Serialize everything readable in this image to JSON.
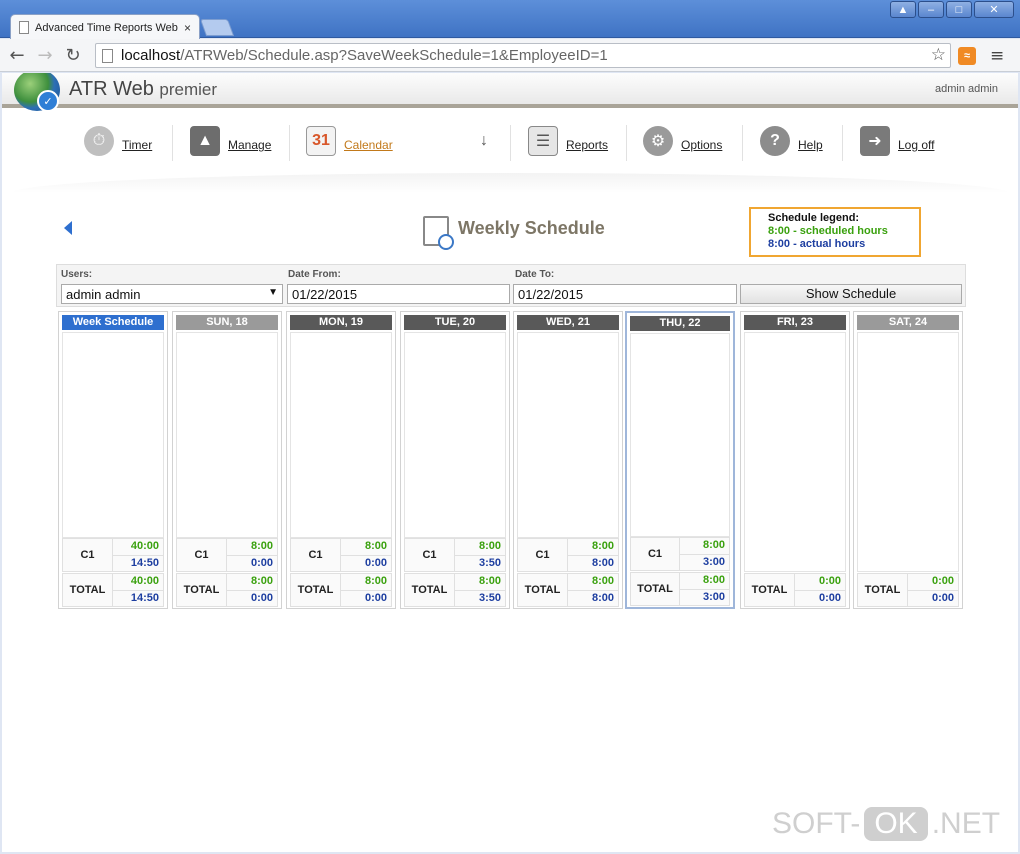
{
  "browser": {
    "tab_title": "Advanced Time Reports Web",
    "tab_close": "×",
    "window_buttons": [
      "▲",
      "–",
      "□",
      "✕"
    ],
    "url_host": "localhost",
    "url_path": "/ATRWeb/Schedule.asp?SaveWeekSchedule=1&EmployeeID=1"
  },
  "app": {
    "brand": "ATR Web",
    "brand_sub": "premier",
    "user": "admin admin"
  },
  "nav": {
    "timer": "Timer",
    "manage": "Manage",
    "calendar": "Calendar",
    "reports": "Reports",
    "options": "Options",
    "help": "Help",
    "logoff": "Log off",
    "calendar_day": "31"
  },
  "page": {
    "title": "Weekly Schedule"
  },
  "legend": {
    "title": "Schedule legend:",
    "scheduled": "8:00 - scheduled hours",
    "actual": "8:00 - actual hours"
  },
  "filters": {
    "users_label": "Users:",
    "users_value": "admin admin",
    "date_from_label": "Date From:",
    "date_from_value": "01/22/2015",
    "date_to_label": "Date To:",
    "date_to_value": "01/22/2015",
    "show_button": "Show Schedule"
  },
  "columns": [
    {
      "header": "Week Schedule",
      "row_label": "C1",
      "sched": "40:00",
      "actual": "14:50",
      "total_label": "TOTAL",
      "total_sched": "40:00",
      "total_actual": "14:50"
    },
    {
      "header": "SUN, 18",
      "row_label": "C1",
      "sched": "8:00",
      "actual": "0:00",
      "total_label": "TOTAL",
      "total_sched": "8:00",
      "total_actual": "0:00"
    },
    {
      "header": "MON, 19",
      "row_label": "C1",
      "sched": "8:00",
      "actual": "0:00",
      "total_label": "TOTAL",
      "total_sched": "8:00",
      "total_actual": "0:00"
    },
    {
      "header": "TUE, 20",
      "row_label": "C1",
      "sched": "8:00",
      "actual": "3:50",
      "total_label": "TOTAL",
      "total_sched": "8:00",
      "total_actual": "3:50"
    },
    {
      "header": "WED, 21",
      "row_label": "C1",
      "sched": "8:00",
      "actual": "8:00",
      "total_label": "TOTAL",
      "total_sched": "8:00",
      "total_actual": "8:00"
    },
    {
      "header": "THU, 22",
      "row_label": "C1",
      "sched": "8:00",
      "actual": "3:00",
      "total_label": "TOTAL",
      "total_sched": "8:00",
      "total_actual": "3:00"
    },
    {
      "header": "FRI, 23",
      "total_label": "TOTAL",
      "total_sched": "0:00",
      "total_actual": "0:00"
    },
    {
      "header": "SAT, 24",
      "total_label": "TOTAL",
      "total_sched": "0:00",
      "total_actual": "0:00"
    }
  ],
  "watermark": {
    "left": "SOFT-",
    "mid": "OK",
    "right": ".NET"
  },
  "colors": {
    "scheduled": "#3aa10e",
    "actual": "#1d3ea0",
    "accent": "#2e6fcf",
    "legend_border": "#f0a631"
  }
}
